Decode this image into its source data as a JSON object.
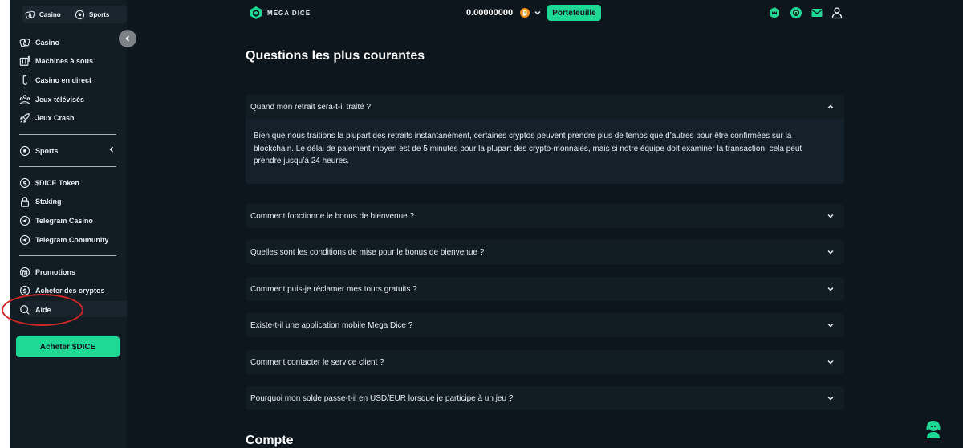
{
  "sidebar": {
    "top_tabs": [
      {
        "label": "Casino",
        "icon": "casino-icon"
      },
      {
        "label": "Sports",
        "icon": "soccer-ball-icon"
      }
    ],
    "group1": [
      {
        "label": "Casino",
        "icon": "casino-icon"
      },
      {
        "label": "Machines à sous",
        "icon": "slot-machine-icon"
      },
      {
        "label": "Casino en direct",
        "icon": "live-casino-icon"
      },
      {
        "label": "Jeux télévisés",
        "icon": "game-show-icon"
      },
      {
        "label": "Jeux Crash",
        "icon": "rocket-icon"
      }
    ],
    "group2": [
      {
        "label": "Sports",
        "icon": "soccer-ball-icon"
      }
    ],
    "group3": [
      {
        "label": "$DICE Token",
        "icon": "dollar-coin-icon"
      },
      {
        "label": "Staking",
        "icon": "lock-icon"
      },
      {
        "label": "Telegram Casino",
        "icon": "telegram-icon"
      },
      {
        "label": "Telegram Community",
        "icon": "telegram-icon"
      }
    ],
    "group4": [
      {
        "label": "Promotions",
        "icon": "gift-icon"
      },
      {
        "label": "Acheter des cryptos",
        "icon": "dollar-coin-icon"
      },
      {
        "label": "Aide",
        "icon": "search-icon"
      }
    ],
    "buy_button": "Acheter $DICE"
  },
  "header": {
    "logo_text": "MEGA DICE",
    "balance": "0.00000000",
    "currency_symbol": "₿",
    "wallet_button": "Portefeuille",
    "icons": [
      "vip-crown-icon",
      "gear-badge-icon",
      "mail-icon",
      "user-icon"
    ]
  },
  "faq": {
    "title": "Questions les plus courantes",
    "open_item": {
      "question": "Quand mon retrait sera-t-il traité ?",
      "answer": "Bien que nous traitions la plupart des retraits instantanément, certaines cryptos peuvent prendre plus de temps que d’autres pour être confirmées sur la blockchain. Le délai de paiement moyen est de 5 minutes pour la plupart des crypto-monnaies, mais si notre équipe doit examiner la transaction, cela peut prendre jusqu’à 24 heures."
    },
    "items": [
      "Comment fonctionne le bonus de bienvenue ?",
      "Quelles sont les conditions de mise pour le bonus de bienvenue ?",
      "Comment puis-je réclamer mes tours gratuits ?",
      "Existe-t-il une application mobile Mega Dice ?",
      "Comment contacter le service client ?",
      "Pourquoi mon solde passe-t-il en USD/EUR lorsque je participe à un jeu ?"
    ]
  },
  "section2_title": "Compte",
  "colors": {
    "accent": "#20d896",
    "bg": "#0c161c",
    "sidebar": "#121c23",
    "annotation": "#d32525"
  }
}
